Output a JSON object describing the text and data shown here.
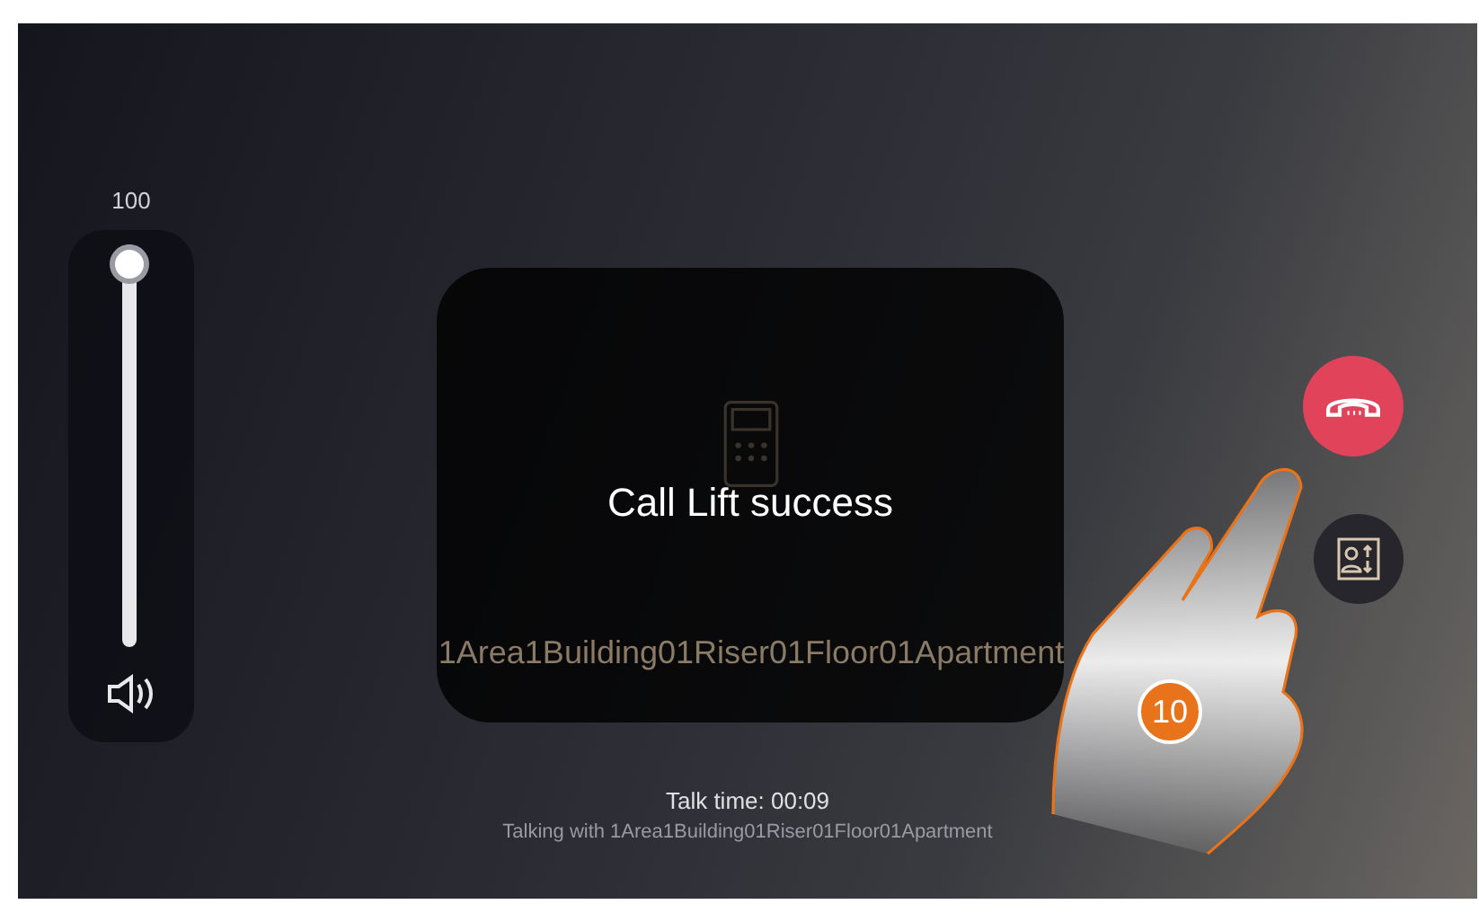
{
  "volume": {
    "value": "100",
    "level": 1
  },
  "dialog": {
    "message": "Call Lift success"
  },
  "callee_name": "1Area1Building01Riser01Floor01Apartment",
  "talk_time": "Talk time: 00:09",
  "talking_with": "Talking with 1Area1Building01Riser01Floor01Apartment",
  "annotation": {
    "step": "10"
  }
}
